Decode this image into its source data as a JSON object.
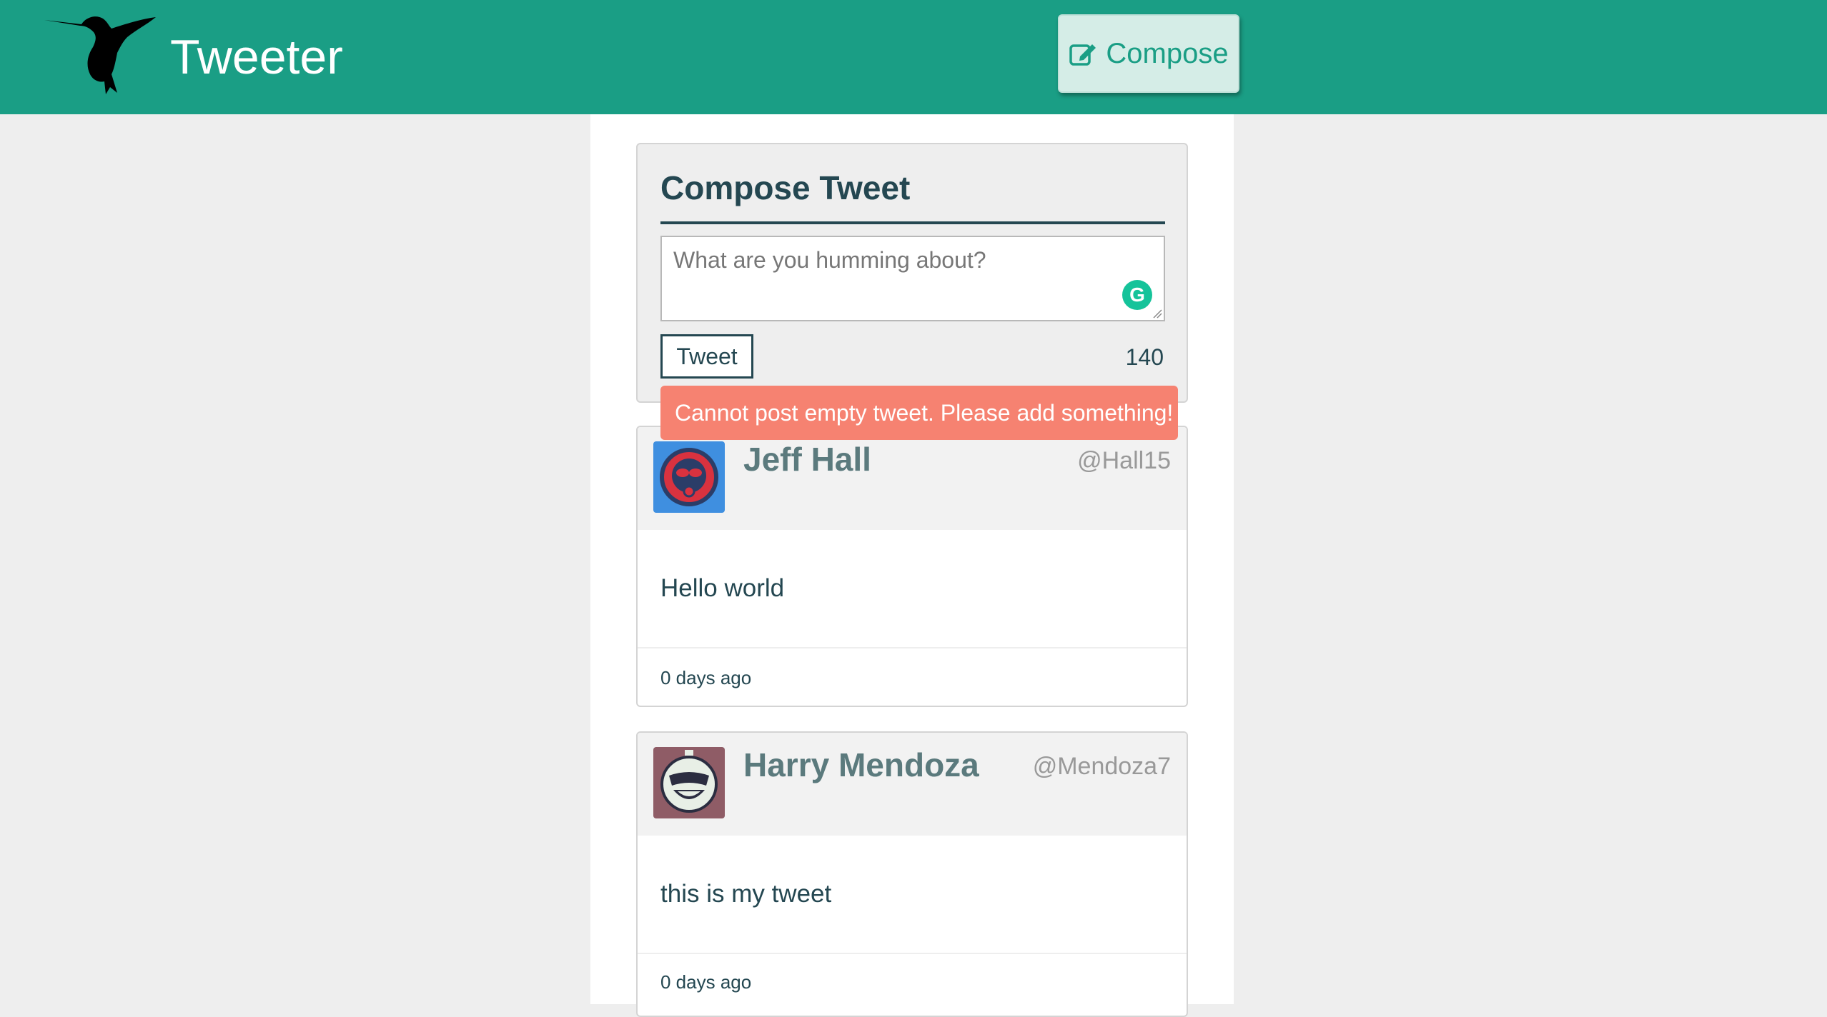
{
  "app": {
    "title": "Tweeter"
  },
  "header": {
    "compose_label": "Compose",
    "compose_icon": "edit-icon"
  },
  "compose": {
    "title": "Compose Tweet",
    "placeholder": "What are you humming about?",
    "tweet_button": "Tweet",
    "counter": "140",
    "error": "Cannot post empty tweet. Please add something!"
  },
  "tweets": [
    {
      "name": "Jeff Hall",
      "handle": "@Hall15",
      "content": "Hello world",
      "time": "0 days ago",
      "avatar_bg": "#3f8fe0"
    },
    {
      "name": "Harry Mendoza",
      "handle": "@Mendoza7",
      "content": "this is my tweet",
      "time": "0 days ago",
      "avatar_bg": "#8f5c66"
    }
  ],
  "colors": {
    "accent": "#1a9e85",
    "error": "#f68271",
    "text_dark": "#244751"
  }
}
